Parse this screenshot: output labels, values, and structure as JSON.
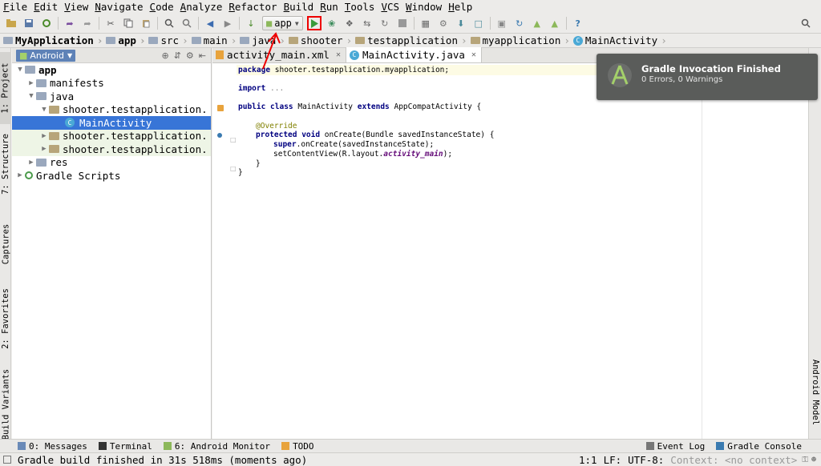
{
  "menu": [
    "File",
    "Edit",
    "View",
    "Navigate",
    "Code",
    "Analyze",
    "Refactor",
    "Build",
    "Run",
    "Tools",
    "VCS",
    "Window",
    "Help"
  ],
  "toolbar": {
    "run_config": "app"
  },
  "breadcrumb": [
    "MyApplication",
    "app",
    "src",
    "main",
    "java",
    "shooter",
    "testapplication",
    "myapplication",
    "MainActivity"
  ],
  "left_tabs": [
    "1: Project",
    "7: Structure",
    "Captures",
    "2: Favorites",
    "Build Variants"
  ],
  "right_tabs": [
    "Android Model"
  ],
  "project": {
    "view": "Android",
    "tree": [
      "app",
      "manifests",
      "java",
      "shooter.testapplication.",
      "MainActivity",
      "shooter.testapplication.",
      "shooter.testapplication.",
      "res",
      "Gradle Scripts"
    ]
  },
  "editor": {
    "tabs": [
      "activity_main.xml",
      "MainActivity.java"
    ],
    "code": {
      "package_kw": "package",
      "package_name": " shooter.testapplication.myapplication;",
      "import_kw": "import",
      "import_rest": " ...",
      "l3_kw1": "public class",
      "l3_t1": " MainActivity ",
      "l3_kw2": "extends",
      "l3_t2": " AppCompatActivity {",
      "ann": "@Override",
      "l5_kw": "protected void",
      "l5_t": " onCreate(Bundle savedInstanceState) {",
      "l6_kw": "super",
      "l6_t": ".onCreate(savedInstanceState);",
      "l7_t1": "setContentView(R.layout.",
      "l7_it": "activity_main",
      "l7_t2": ");",
      "close1": "}",
      "close2": "}"
    }
  },
  "notification": {
    "title": "Gradle Invocation Finished",
    "message": "0 Errors, 0 Warnings"
  },
  "bottom_tools": {
    "messages": "0: Messages",
    "terminal": "Terminal",
    "android_monitor": "6: Android Monitor",
    "todo": "TODO",
    "event_log": "Event Log",
    "gradle_console": "Gradle Console"
  },
  "status": {
    "message": "Gradle build finished in 31s 518ms (moments ago)",
    "position": "1:1",
    "line_sep": "LF:",
    "encoding": "UTF-8:",
    "context": "Context: <no context>"
  }
}
